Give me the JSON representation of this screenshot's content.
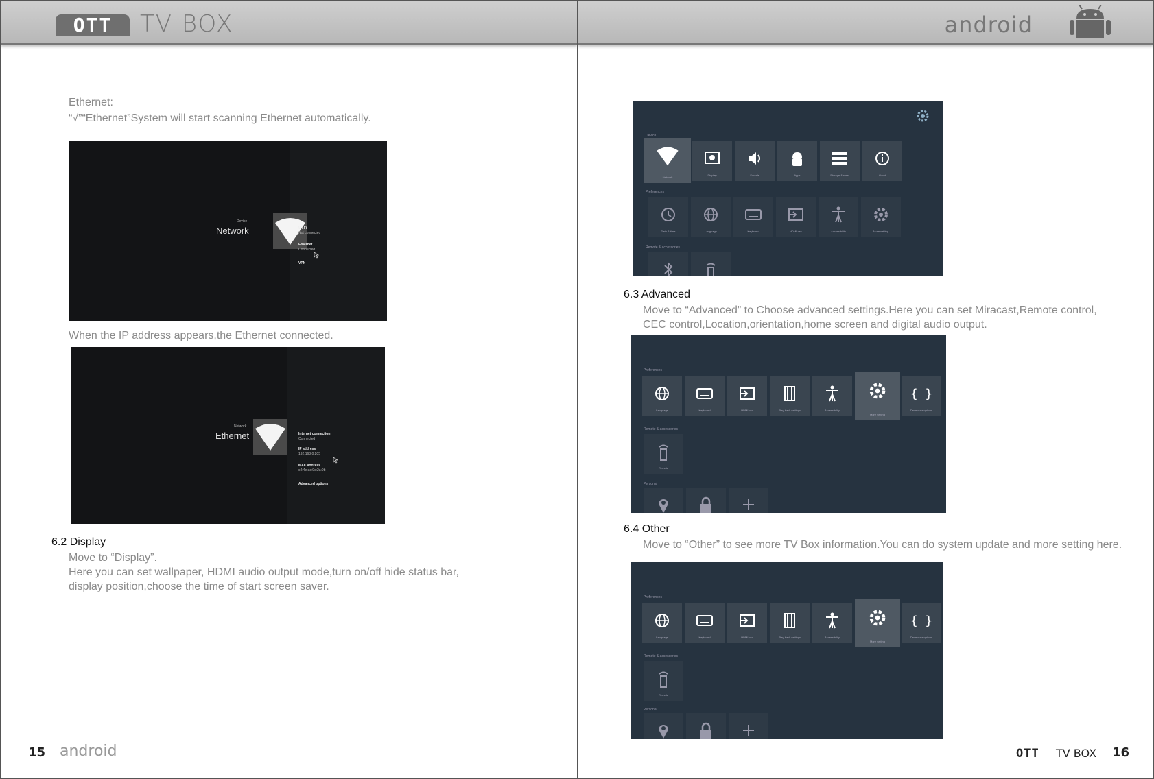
{
  "header": {
    "left_badge": "OTT",
    "left_title": "TV BOX",
    "right_brand": "android"
  },
  "left_page": {
    "ethernet_label": "Ethernet:",
    "ethernet_instruction": "“√”“Ethernet”System will start scanning Ethernet automatically.",
    "shot1": {
      "device_label": "Device",
      "title": "Network",
      "items": [
        {
          "label": "Wi-Fi",
          "sub": "Not connected"
        },
        {
          "label": "Ethernet",
          "sub": "Connected"
        },
        {
          "label": "VPN",
          "sub": ""
        }
      ]
    },
    "ip_text": "When the IP address appears,the Ethernet connected.",
    "shot2": {
      "network_label": "Network",
      "title": "Ethernet",
      "items": [
        {
          "label": "Internet connection",
          "sub": "Connected"
        },
        {
          "label": "IP address",
          "sub": "192.168.0.205"
        },
        {
          "label": "MAC address",
          "sub": "c4:4e:ac:9c:2a:9b"
        },
        {
          "label": "Advanced options",
          "sub": ""
        }
      ]
    },
    "display_heading": "6.2 Display",
    "display_line1": "Move to “Display”.",
    "display_line2": "Here you can set wallpaper, HDMI audio output mode,turn on/off hide status bar,",
    "display_line3": "display position,choose the time of start screen saver.",
    "footer_page": "15",
    "footer_brand": "android"
  },
  "right_page": {
    "shot_top": {
      "device_section": "Device",
      "device_tiles": [
        "Network",
        "Display",
        "Sounds",
        "Apps",
        "Storage & reset",
        "About"
      ],
      "preferences_section": "Preferences",
      "pref_tiles": [
        "Date & time",
        "Language",
        "Keyboard",
        "HDMI-cec",
        "Accessibility",
        "More setting"
      ],
      "remote_section": "Remote & accessories"
    },
    "advanced_heading": "6.3 Advanced",
    "advanced_line1": "Move to “Advanced” to Choose advanced settings.Here you can set Miracast,Remote control,",
    "advanced_line2": "CEC control,Location,orientation,home screen and digital audio output.",
    "shot_mid": {
      "preferences_section": "Preferences",
      "pref_tiles": [
        "Language",
        "Keyboard",
        "HDMI cec",
        "Play back settings",
        "Accessibility",
        "More setting",
        "Developer options"
      ],
      "remote_section": "Remote & accessories",
      "remote_tile": "Remote",
      "personal_section": "Personal"
    },
    "other_heading": "6.4 Other",
    "other_line1": "Move to “Other” to see more TV Box information.You can do system update and more setting here.",
    "shot_bot": {
      "preferences_section": "Preferences",
      "pref_tiles": [
        "Language",
        "Keyboard",
        "HDMI cec",
        "Play back settings",
        "Accessibility",
        "More setting",
        "Developer options"
      ],
      "remote_section": "Remote & accessories",
      "remote_tile": "Remote",
      "personal_section": "Personal"
    },
    "footer_ott": "OTT",
    "footer_tvbox": "TV BOX",
    "footer_page": "16"
  }
}
